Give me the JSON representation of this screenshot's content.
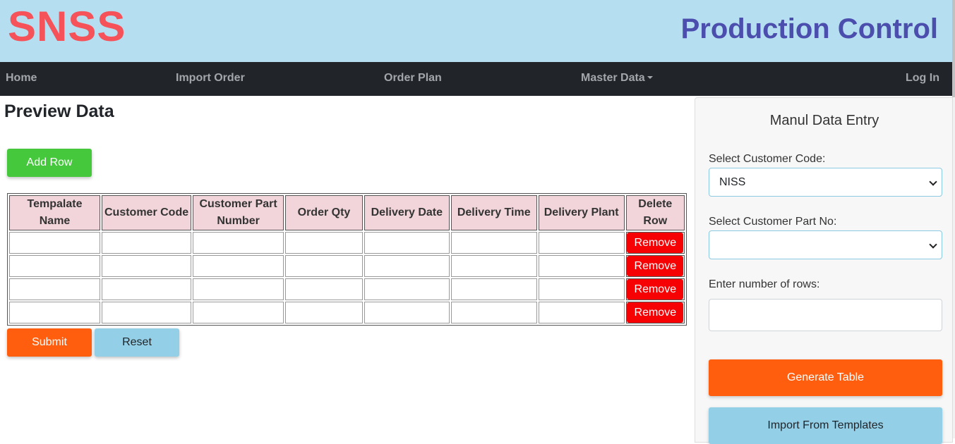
{
  "header": {
    "brand": "SNSS",
    "app_title": "Production Control"
  },
  "nav": {
    "home": "Home",
    "import_order": "Import Order",
    "order_plan": "Order Plan",
    "master_data": "Master Data",
    "login": "Log In"
  },
  "page": {
    "heading": "Preview Data",
    "add_row_label": "Add Row",
    "submit_label": "Submit",
    "reset_label": "Reset"
  },
  "table": {
    "columns": [
      "Tempalate Name",
      "Customer Code",
      "Customer Part Number",
      "Order Qty",
      "Delivery Date",
      "Delivery Time",
      "Delivery Plant",
      "Delete Row"
    ],
    "row_count": 4,
    "remove_label": "Remove"
  },
  "panel": {
    "title": "Manul Data Entry",
    "customer_code_label": "Select Customer Code:",
    "customer_code_value": "NISS",
    "part_no_label": "Select Customer Part No:",
    "part_no_value": "",
    "rows_label": "Enter number of rows:",
    "rows_value": "",
    "generate_label": "Generate Table",
    "import_label": "Import From Templates"
  },
  "colors": {
    "brand": "#f5525a",
    "title": "#4b4ead",
    "header_bg": "#b5dff0",
    "navbar_bg": "#212529",
    "add_button": "#45c83c",
    "primary_orange": "#ff5e0e",
    "secondary_blue": "#93d0e8",
    "remove_red": "#f60205",
    "table_header_bg": "#f2d5da"
  }
}
